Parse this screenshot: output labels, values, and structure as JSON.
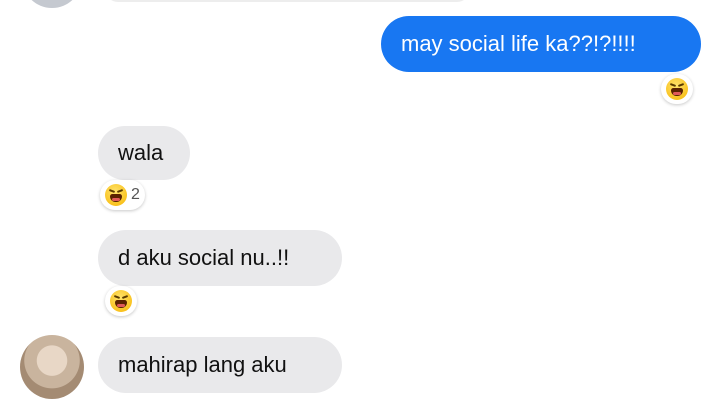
{
  "messages": [
    {
      "from": "me",
      "text": "may social life ka??!?!!!!",
      "reaction": {
        "emoji": "laughing-face-icon",
        "count": ""
      }
    },
    {
      "from": "them",
      "text": "wala",
      "reaction": {
        "emoji": "laughing-face-icon",
        "count": "2"
      }
    },
    {
      "from": "them",
      "text": "d aku social nu..!!",
      "reaction": {
        "emoji": "laughing-face-icon",
        "count": ""
      }
    },
    {
      "from": "them",
      "text": "mahirap lang aku"
    }
  ],
  "colors": {
    "outgoing_bubble": "#1877f2",
    "incoming_bubble": "#e9e9eb",
    "background": "#ffffff"
  }
}
